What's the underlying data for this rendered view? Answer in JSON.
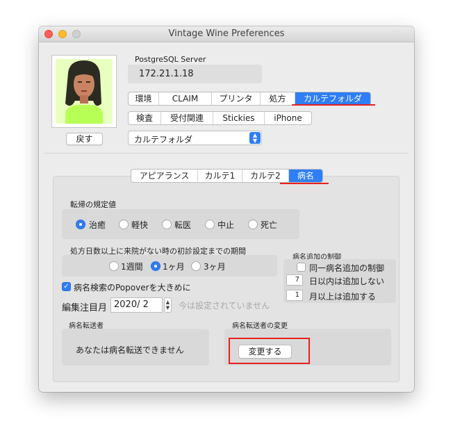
{
  "window": {
    "title": "Vintage Wine Preferences"
  },
  "server": {
    "label": "PostgreSQL Server",
    "address": "172.21.1.18"
  },
  "back_button": "戻す",
  "tabs_row1": [
    "環境",
    "CLAIM",
    "プリンタ",
    "処方",
    "カルテフォルダ"
  ],
  "tabs_row2": [
    "検査",
    "受付関連",
    "Stickies",
    "iPhone"
  ],
  "popup": {
    "value": "カルテフォルダ"
  },
  "inner_tabs": [
    "アピアランス",
    "カルテ1",
    "カルテ2",
    "病名"
  ],
  "outcome": {
    "title": "転帰の規定値",
    "options": [
      "治癒",
      "軽快",
      "転医",
      "中止",
      "死亡"
    ],
    "selected": "治癒"
  },
  "period": {
    "title": "処方日数以上に来院がない時の初診設定までの期間",
    "options": [
      "1週間",
      "1ヶ月",
      "3ヶ月"
    ],
    "selected": "1ヶ月"
  },
  "add_control": {
    "title": "病名追加の制御",
    "checkbox_label": "同一病名追加の制御",
    "days_value": "7",
    "days_label": "日以内は追加しない",
    "months_value": "1",
    "months_label": "月以上は追加する"
  },
  "popover": {
    "label": "病名検索のPopoverを大きめに",
    "checked": true
  },
  "edit_month": {
    "label": "編集注目月",
    "value": "2020/  2",
    "note": "今は設定されていません"
  },
  "transfer": {
    "title": "病名転送者",
    "message": "あなたは病名転送できません",
    "change_title": "病名転送者の変更",
    "change_button": "変更する"
  },
  "colors": {
    "accent": "#2f7ef5",
    "annotation_red": "#e8201e"
  }
}
